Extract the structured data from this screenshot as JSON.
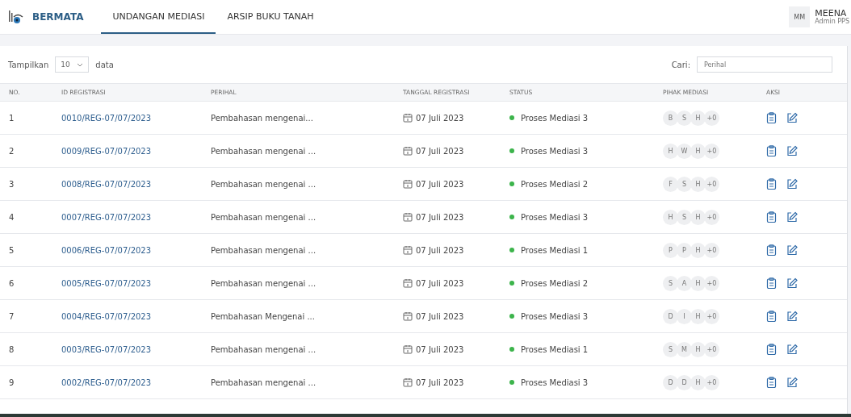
{
  "navbar": {
    "brand": "BERMATA",
    "tabs": [
      {
        "label": "UNDANGAN MEDIASI",
        "selected": true
      },
      {
        "label": "ARSIP BUKU TANAH",
        "selected": false
      }
    ],
    "user": {
      "initials": "MM",
      "name": "MEENA",
      "role": "Admin PPS"
    }
  },
  "toolbar": {
    "show_label": "Tampilkan",
    "page_size": "10",
    "show_suffix": "data",
    "search_label": "Cari:",
    "search_placeholder": "Perihal"
  },
  "table": {
    "columns": [
      "NO.",
      "ID REGISTRASI",
      "PERIHAL",
      "TANGGAL REGISTRASI",
      "STATUS",
      "PIHAK MEDIASI",
      "AKSI"
    ],
    "rows": [
      {
        "no": "1",
        "id": "0010/REG-07/07/2023",
        "perihal": "Pembahasan mengenai...",
        "date": "07 Juli 2023",
        "status": "Proses Mediasi 3",
        "color": "#3cb44b",
        "parties": [
          "B",
          "S",
          "H",
          "+0"
        ]
      },
      {
        "no": "2",
        "id": "0009/REG-07/07/2023",
        "perihal": "Pembahasan mengenai ...",
        "date": "07 Juli 2023",
        "status": "Proses Mediasi 3",
        "color": "#3cb44b",
        "parties": [
          "H",
          "W",
          "H",
          "+0"
        ]
      },
      {
        "no": "3",
        "id": "0008/REG-07/07/2023",
        "perihal": "Pembahasan mengenai ...",
        "date": "07 Juli 2023",
        "status": "Proses Mediasi 2",
        "color": "#3cb44b",
        "parties": [
          "F",
          "S",
          "H",
          "+0"
        ]
      },
      {
        "no": "4",
        "id": "0007/REG-07/07/2023",
        "perihal": "Pembahasan mengenai ...",
        "date": "07 Juli 2023",
        "status": "Proses Mediasi 3",
        "color": "#3cb44b",
        "parties": [
          "H",
          "S",
          "H",
          "+0"
        ]
      },
      {
        "no": "5",
        "id": "0006/REG-07/07/2023",
        "perihal": "Pembahasan mengenai ...",
        "date": "07 Juli 2023",
        "status": "Proses Mediasi 1",
        "color": "#3cb44b",
        "parties": [
          "P",
          "P",
          "H",
          "+0"
        ]
      },
      {
        "no": "6",
        "id": "0005/REG-07/07/2023",
        "perihal": "Pembahasan mengenai ...",
        "date": "07 Juli 2023",
        "status": "Proses Mediasi 2",
        "color": "#3cb44b",
        "parties": [
          "S",
          "A",
          "H",
          "+0"
        ]
      },
      {
        "no": "7",
        "id": "0004/REG-07/07/2023",
        "perihal": "Pembahasan Mengenai ...",
        "date": "07 Juli 2023",
        "status": "Proses Mediasi 3",
        "color": "#3cb44b",
        "parties": [
          "D",
          "I",
          "H",
          "+0"
        ]
      },
      {
        "no": "8",
        "id": "0003/REG-07/07/2023",
        "perihal": "Pembahasan mengenai ...",
        "date": "07 Juli 2023",
        "status": "Proses Mediasi 1",
        "color": "#3cb44b",
        "parties": [
          "S",
          "M",
          "H",
          "+0"
        ]
      },
      {
        "no": "9",
        "id": "0002/REG-07/07/2023",
        "perihal": "Pembahasan mengenai ...",
        "date": "07 Juli 2023",
        "status": "Proses Mediasi 3",
        "color": "#3cb44b",
        "parties": [
          "D",
          "D",
          "H",
          "+0"
        ]
      }
    ]
  }
}
